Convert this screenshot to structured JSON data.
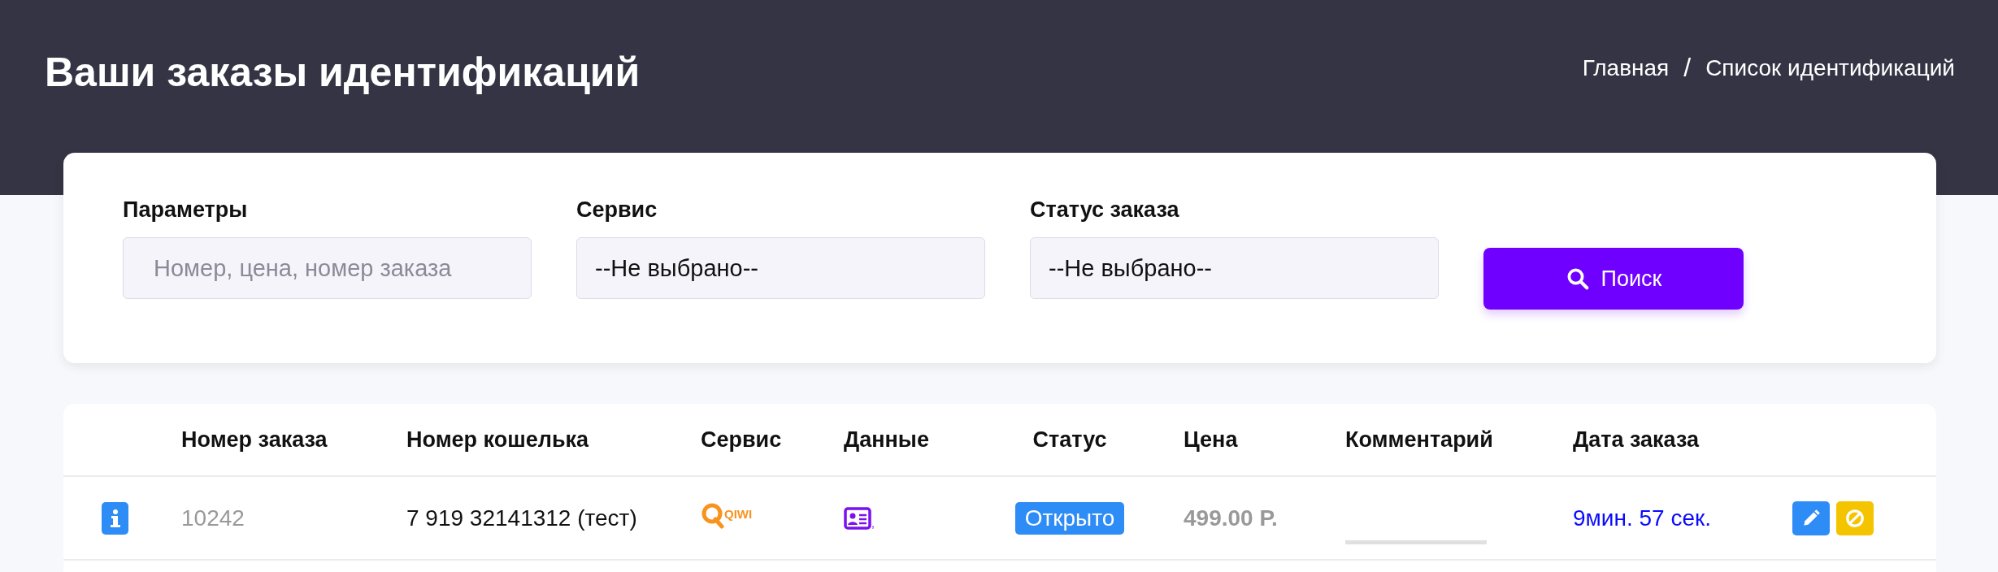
{
  "header": {
    "title": "Ваши заказы идентификаций",
    "breadcrumbs": [
      "Главная",
      "Список идентификаций"
    ],
    "separator": "/"
  },
  "filters": [
    {
      "kind": "text",
      "label": "Параметры",
      "placeholder": "Номер, цена, номер заказа"
    },
    {
      "kind": "select",
      "label": "Сервис",
      "value": "--Не выбрано--"
    },
    {
      "kind": "select",
      "label": "Статус заказа",
      "value": "--Не выбрано--"
    }
  ],
  "search_button": "Поиск",
  "table": {
    "columns": [
      "Номер заказа",
      "Номер кошелька",
      "Сервис",
      "Данные",
      "Статус",
      "Цена",
      "Комментарий",
      "Дата заказа"
    ],
    "rows": [
      {
        "order": "10242",
        "wallet": "7 919 32141312 (тест)",
        "service": {
          "kind": "qiwi",
          "logo_text": "QIWI"
        },
        "data_suffix": ",",
        "status": {
          "label": "Открыто",
          "color": "#2d8cf5"
        },
        "price": "499.00 Р.",
        "date": "9мин. 57 сек.",
        "actions": [
          {
            "kind": "edit"
          },
          {
            "kind": "cancel"
          }
        ]
      }
    ]
  }
}
